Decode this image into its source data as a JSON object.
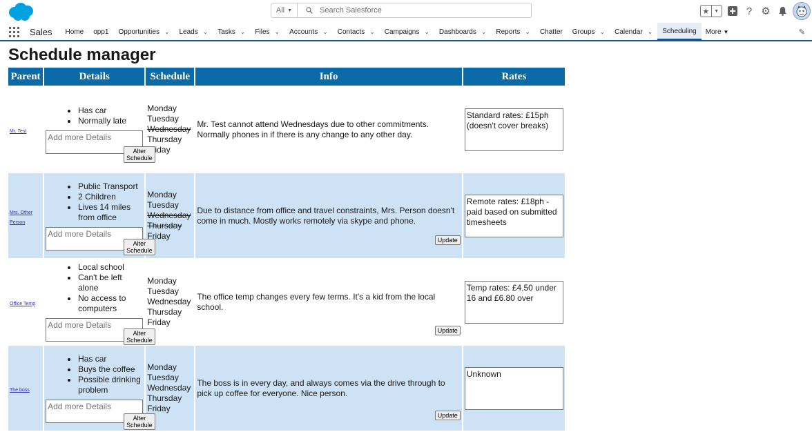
{
  "header": {
    "search_scope": "All",
    "search_placeholder": "Search Salesforce"
  },
  "nav": {
    "app_name": "Sales",
    "items": [
      {
        "label": "Home",
        "dropdown": false
      },
      {
        "label": "opp1",
        "dropdown": false
      },
      {
        "label": "Opportunities",
        "dropdown": true
      },
      {
        "label": "Leads",
        "dropdown": true
      },
      {
        "label": "Tasks",
        "dropdown": true
      },
      {
        "label": "Files",
        "dropdown": true
      },
      {
        "label": "Accounts",
        "dropdown": true
      },
      {
        "label": "Contacts",
        "dropdown": true
      },
      {
        "label": "Campaigns",
        "dropdown": true
      },
      {
        "label": "Dashboards",
        "dropdown": true
      },
      {
        "label": "Reports",
        "dropdown": true
      },
      {
        "label": "Chatter",
        "dropdown": false
      },
      {
        "label": "Groups",
        "dropdown": true
      },
      {
        "label": "Calendar",
        "dropdown": true
      },
      {
        "label": "Scheduling",
        "dropdown": false,
        "active": true
      }
    ],
    "more_label": "More"
  },
  "page": {
    "title": "Schedule manager",
    "columns": [
      "Parent",
      "Details",
      "Schedule",
      "Info",
      "Rates"
    ],
    "details_placeholder": "Add more Details",
    "alter_label": "Alter Schedule",
    "update_label": "Update"
  },
  "rows": [
    {
      "parent": "Mr. Test",
      "details": [
        "Has car",
        "Normally late"
      ],
      "schedule": [
        {
          "day": "Monday",
          "struck": false
        },
        {
          "day": "Tuesday",
          "struck": false
        },
        {
          "day": "Wednesday",
          "struck": true
        },
        {
          "day": "Thursday",
          "struck": false
        },
        {
          "day": "Friday",
          "struck": false
        }
      ],
      "info": "Mr. Test cannot attend Wednesdays due to other commitments. Normally phones in if there is any change to any other day.",
      "rates": "Standard rates: £15ph (doesn't cover breaks)",
      "has_update": false
    },
    {
      "parent": "Mrs. Other Person",
      "details": [
        "Public Transport",
        "2 Children",
        "Lives 14 miles from office"
      ],
      "schedule": [
        {
          "day": "Monday",
          "struck": false
        },
        {
          "day": "Tuesday",
          "struck": false
        },
        {
          "day": "Wednesday",
          "struck": true
        },
        {
          "day": "Thursday",
          "struck": true
        },
        {
          "day": "Friday",
          "struck": false
        }
      ],
      "info": "Due to distance from office and travel constraints, Mrs. Person doesn't come in much. Mostly works remotely via skype and phone.",
      "rates": "Remote rates: £18ph - paid based on submitted timesheets",
      "has_update": true
    },
    {
      "parent": "Office Temp",
      "details": [
        "Local school",
        "Can't be left alone",
        "No access to computers"
      ],
      "schedule": [
        {
          "day": "Monday",
          "struck": false
        },
        {
          "day": "Tuesday",
          "struck": false
        },
        {
          "day": "Wednesday",
          "struck": false
        },
        {
          "day": "Thursday",
          "struck": false
        },
        {
          "day": "Friday",
          "struck": false
        }
      ],
      "info": "The office temp changes every few terms. It's a kid from the local school.",
      "rates": "Temp rates: £4.50 under 16 and £6.80 over",
      "has_update": true
    },
    {
      "parent": "The boss",
      "details": [
        "Has car",
        "Buys the coffee",
        "Possible drinking problem"
      ],
      "schedule": [
        {
          "day": "Monday",
          "struck": false
        },
        {
          "day": "Tuesday",
          "struck": false
        },
        {
          "day": "Wednesday",
          "struck": false
        },
        {
          "day": "Thursday",
          "struck": false
        },
        {
          "day": "Friday",
          "struck": false
        }
      ],
      "info": "The boss is in every day, and always comes via the drive through to pick up coffee for everyone. Nice person.",
      "rates": "Unknown",
      "has_update": true
    }
  ],
  "colors": {
    "header_blue": "#0a6ba8",
    "row_alt": "#cde2f4",
    "nav_accent": "#1b5297"
  }
}
